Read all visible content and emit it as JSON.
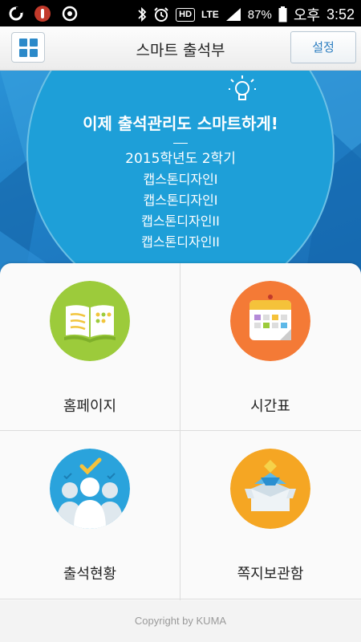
{
  "status_bar": {
    "battery_percent": "87%",
    "ampm": "오후",
    "time": "3:52",
    "network": "LTE",
    "hd_label": "HD"
  },
  "app_bar": {
    "title": "스마트 출석부",
    "settings_label": "설정"
  },
  "banner": {
    "headline": "이제 출석관리도 스마트하게!",
    "semester": "2015학년도 2학기",
    "courses": [
      "캡스톤디자인I",
      "캡스톤디자인I",
      "캡스톤디자인II",
      "캡스톤디자인II"
    ]
  },
  "menu": {
    "items": [
      {
        "label": "홈페이지",
        "icon": "book-icon",
        "color": "#9ccb3b"
      },
      {
        "label": "시간표",
        "icon": "calendar-icon",
        "color": "#f47a36"
      },
      {
        "label": "출석현황",
        "icon": "attendance-people-icon",
        "color": "#2aa3dc"
      },
      {
        "label": "쪽지보관함",
        "icon": "message-box-icon",
        "color": "#f5a623"
      }
    ]
  },
  "footer": {
    "copyright": "Copyright by KUMA"
  }
}
